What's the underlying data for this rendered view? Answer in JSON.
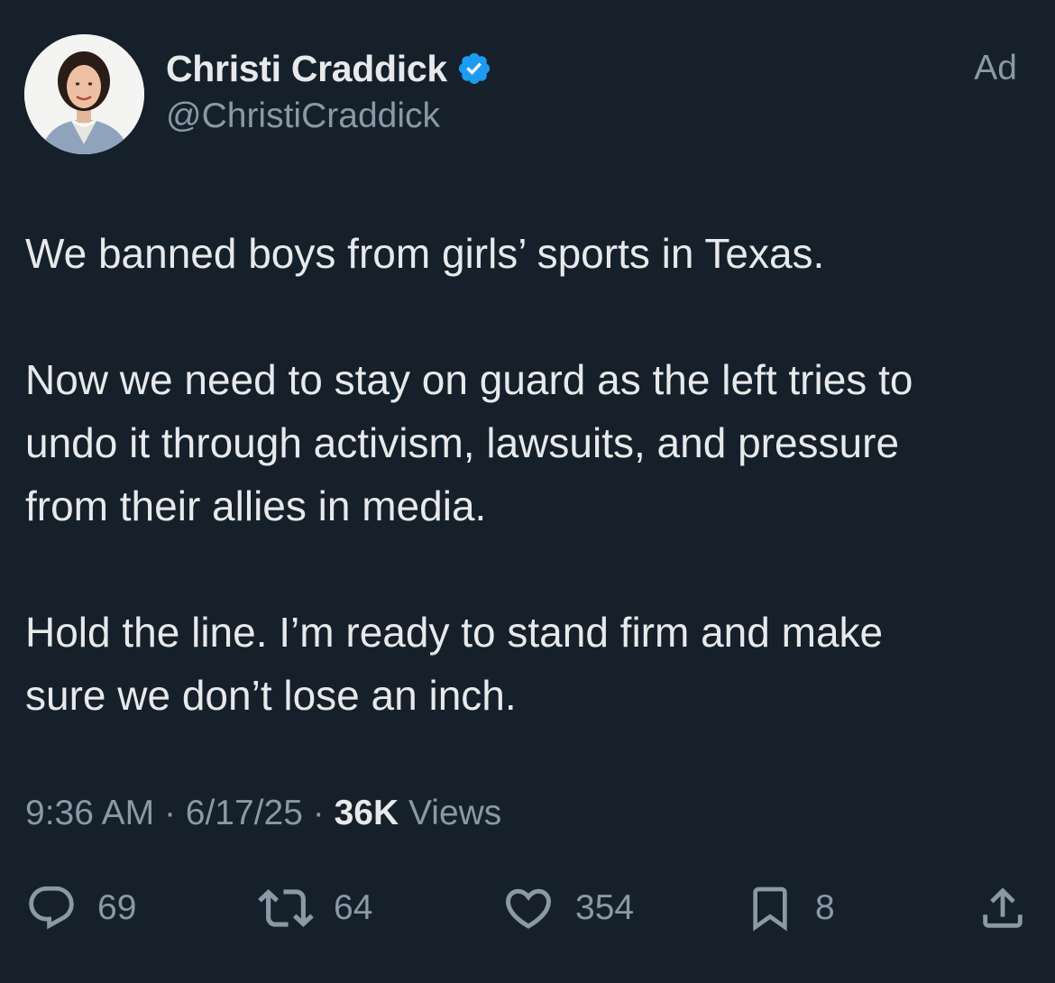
{
  "author": {
    "display_name": "Christi Craddick",
    "handle": "@ChristiCraddick",
    "verified": true,
    "verified_color": "#1d9bf0"
  },
  "ad_label": "Ad",
  "tweet": {
    "paragraphs": [
      "We banned boys from girls’ sports in Texas.",
      "Now we need to stay on guard as the left tries to\nundo it through activism, lawsuits, and pressure\nfrom their allies in media.",
      "Hold the line. I’m ready to stand firm and make\nsure we don’t lose an inch."
    ]
  },
  "meta": {
    "time": "9:36 AM",
    "date": "6/17/25",
    "separator": "·",
    "views_count": "36K",
    "views_label": "Views"
  },
  "actions": {
    "reply": {
      "icon": "reply-icon",
      "count": "69"
    },
    "repost": {
      "icon": "repost-icon",
      "count": "64"
    },
    "like": {
      "icon": "heart-icon",
      "count": "354"
    },
    "bookmark": {
      "icon": "bookmark-icon",
      "count": "8"
    },
    "share": {
      "icon": "share-icon"
    }
  },
  "colors": {
    "background": "#15202b",
    "primary_text": "#e7e9ea",
    "secondary_text": "#8b98a5"
  }
}
